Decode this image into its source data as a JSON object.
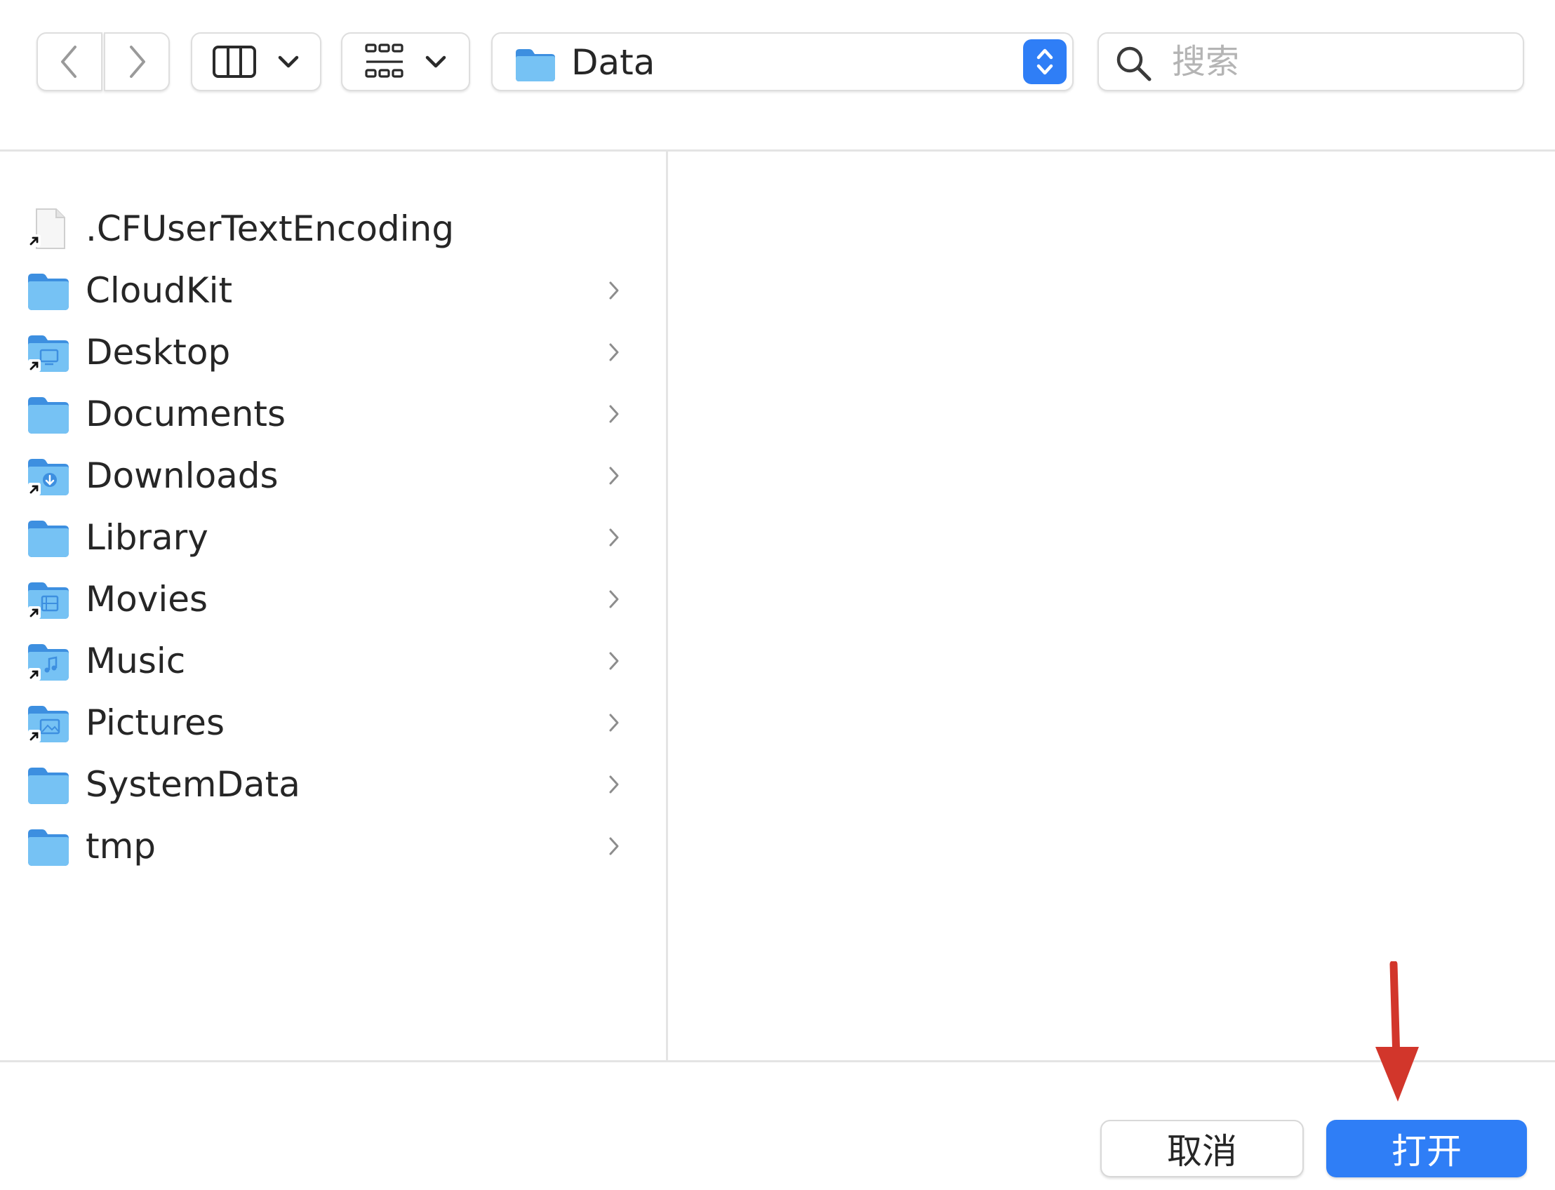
{
  "toolbar": {
    "back_icon": "chevron-left-icon",
    "forward_icon": "chevron-right-icon",
    "view_mode_icon": "column-view-icon",
    "group_icon": "icon-grid-icon",
    "path": {
      "label": "Data",
      "icon": "folder-icon"
    },
    "search": {
      "placeholder": "搜索",
      "value": "",
      "icon": "search-icon"
    }
  },
  "files": [
    {
      "name": ".CFUserTextEncoding",
      "type": "file",
      "alias": true,
      "has_children": false
    },
    {
      "name": "CloudKit",
      "type": "folder",
      "alias": false,
      "has_children": true
    },
    {
      "name": "Desktop",
      "type": "folder-desktop",
      "alias": true,
      "has_children": true
    },
    {
      "name": "Documents",
      "type": "folder",
      "alias": false,
      "has_children": true
    },
    {
      "name": "Downloads",
      "type": "folder-downloads",
      "alias": true,
      "has_children": true
    },
    {
      "name": "Library",
      "type": "folder",
      "alias": false,
      "has_children": true
    },
    {
      "name": "Movies",
      "type": "folder-movies",
      "alias": true,
      "has_children": true
    },
    {
      "name": "Music",
      "type": "folder-music",
      "alias": true,
      "has_children": true
    },
    {
      "name": "Pictures",
      "type": "folder-pictures",
      "alias": true,
      "has_children": true
    },
    {
      "name": "SystemData",
      "type": "folder",
      "alias": false,
      "has_children": true
    },
    {
      "name": "tmp",
      "type": "folder",
      "alias": false,
      "has_children": true
    }
  ],
  "footer": {
    "cancel_label": "取消",
    "open_label": "打开"
  },
  "colors": {
    "accent": "#2f7ef6",
    "folder_blue": "#6fbdf2",
    "annotation_arrow": "#d2362b"
  }
}
